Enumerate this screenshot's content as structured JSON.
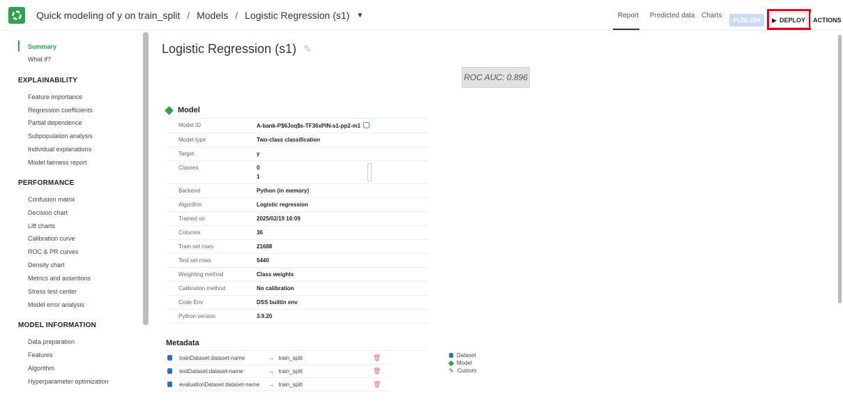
{
  "header": {
    "breadcrumb": [
      "Quick modeling of y on train_split",
      "Models",
      "Logistic Regression (s1)"
    ],
    "tabs": [
      "Report",
      "Predicted data",
      "Charts"
    ],
    "publish_label": "PUBLISH",
    "deploy_label": "DEPLOY",
    "actions_label": "ACTIONS"
  },
  "sidebar": {
    "top_items": [
      "Summary",
      "What if?"
    ],
    "sections": [
      {
        "title": "EXPLAINABILITY",
        "items": [
          "Feature importance",
          "Regression coefficients",
          "Partial dependence",
          "Subpopulation analysis",
          "Individual explanations",
          "Model fairness report"
        ]
      },
      {
        "title": "PERFORMANCE",
        "items": [
          "Confusion matrix",
          "Decision chart",
          "Lift charts",
          "Calibration curve",
          "ROC & PR curves",
          "Density chart",
          "Metrics and assertions",
          "Stress test center",
          "Model error analysis"
        ]
      },
      {
        "title": "MODEL INFORMATION",
        "items": [
          "Data preparation",
          "Features",
          "Algorithm",
          "Hyperparameter optimization"
        ]
      }
    ]
  },
  "main": {
    "title": "Logistic Regression (s1)",
    "roc_label": "ROC AUC: 0.896",
    "model_section_title": "Model",
    "model_rows": [
      {
        "key": "Model ID",
        "value": "A-bank-P$6Joq$s-TF36xPlN-s1-pp2-m1"
      },
      {
        "key": "Model type",
        "value": "Two-class classification"
      },
      {
        "key": "Target",
        "value": "y"
      },
      {
        "key": "Classes",
        "values": [
          "0",
          "1"
        ]
      },
      {
        "key": "Backend",
        "value": "Python (in memory)"
      },
      {
        "key": "Algorithm",
        "value": "Logistic regression"
      },
      {
        "key": "Trained on",
        "value": "2025/02/19 16:09"
      },
      {
        "key": "Columns",
        "value": "36"
      },
      {
        "key": "Train set rows",
        "value": "21688"
      },
      {
        "key": "Test set rows",
        "value": "5440"
      },
      {
        "key": "Weighting method",
        "value": "Class weights"
      },
      {
        "key": "Calibration method",
        "value": "No calibration"
      },
      {
        "key": "Code Env",
        "value": "DSS builtin env"
      },
      {
        "key": "Python version",
        "value": "3.9.20"
      }
    ],
    "metadata_title": "Metadata",
    "metadata_rows": [
      {
        "key": "trainDataset:dataset-name",
        "value": "train_split"
      },
      {
        "key": "testDataset:dataset-name",
        "value": "train_split"
      },
      {
        "key": "evaluationDataset:dataset-name",
        "value": "train_split"
      }
    ],
    "legend": [
      "Dataset",
      "Model",
      "Custom"
    ]
  }
}
